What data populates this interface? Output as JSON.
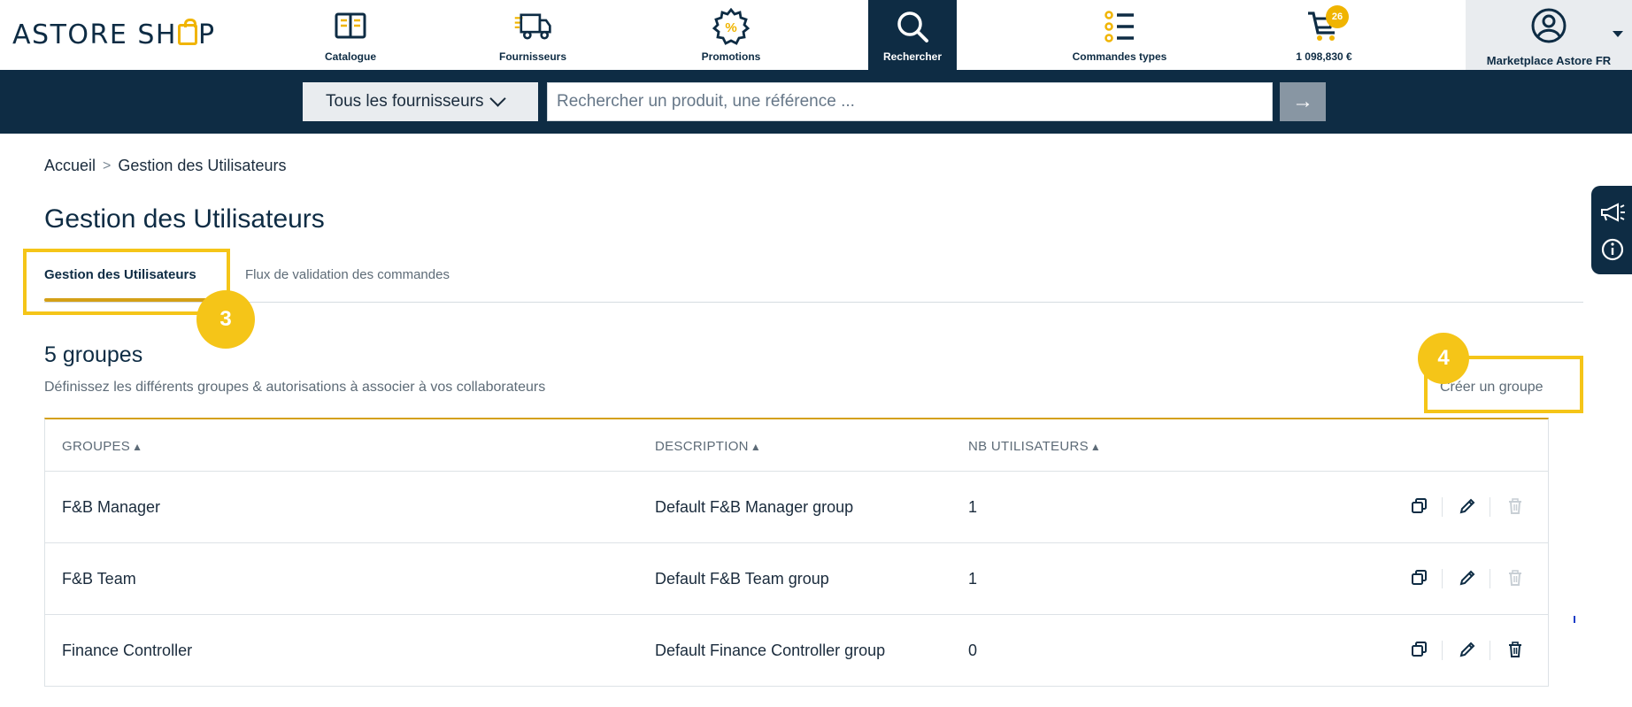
{
  "brand": {
    "name_before": "ASTORE SH",
    "name_after": "P"
  },
  "nav": {
    "items": [
      {
        "label": "Catalogue",
        "icon": "book-icon"
      },
      {
        "label": "Fournisseurs",
        "icon": "truck-icon"
      },
      {
        "label": "Promotions",
        "icon": "discount-badge-icon"
      },
      {
        "label": "Rechercher",
        "icon": "search-icon",
        "active": true
      },
      {
        "label": "Commandes types",
        "icon": "list-icon"
      },
      {
        "label": "1 098,830 €",
        "icon": "cart-icon",
        "badge": "26"
      }
    ],
    "account_label": "Marketplace Astore FR"
  },
  "search": {
    "supplier_select": "Tous les fournisseurs",
    "placeholder": "Rechercher un produit, une référence ...",
    "go_symbol": "→"
  },
  "breadcrumb": {
    "home": "Accueil",
    "current": "Gestion des Utilisateurs"
  },
  "page": {
    "title": "Gestion des Utilisateurs"
  },
  "tabs": [
    {
      "label": "Gestion des Utilisateurs",
      "active": true
    },
    {
      "label": "Flux de validation des commandes",
      "active": false
    }
  ],
  "steps": {
    "tab_step": "3",
    "create_step": "4"
  },
  "groups": {
    "title": "5 groupes",
    "subtitle": "Définissez les différents groupes & autorisations à associer à vos collaborateurs",
    "create_label": "Créer un groupe"
  },
  "table": {
    "headers": [
      "GROUPES",
      "DESCRIPTION",
      "NB UTILISATEURS"
    ],
    "sort_symbol": "▲",
    "rows": [
      {
        "name": "F&B Manager",
        "description": "Default F&B Manager group",
        "users": "1",
        "delete_enabled": false
      },
      {
        "name": "F&B Team",
        "description": "Default F&B Team group",
        "users": "1",
        "delete_enabled": false
      },
      {
        "name": "Finance Controller",
        "description": "Default Finance Controller group",
        "users": "0",
        "delete_enabled": true
      }
    ]
  },
  "colors": {
    "navy": "#0e2c44",
    "accent": "#f0b400",
    "highlight": "#f5c518",
    "tab_underline": "#d4a017"
  }
}
